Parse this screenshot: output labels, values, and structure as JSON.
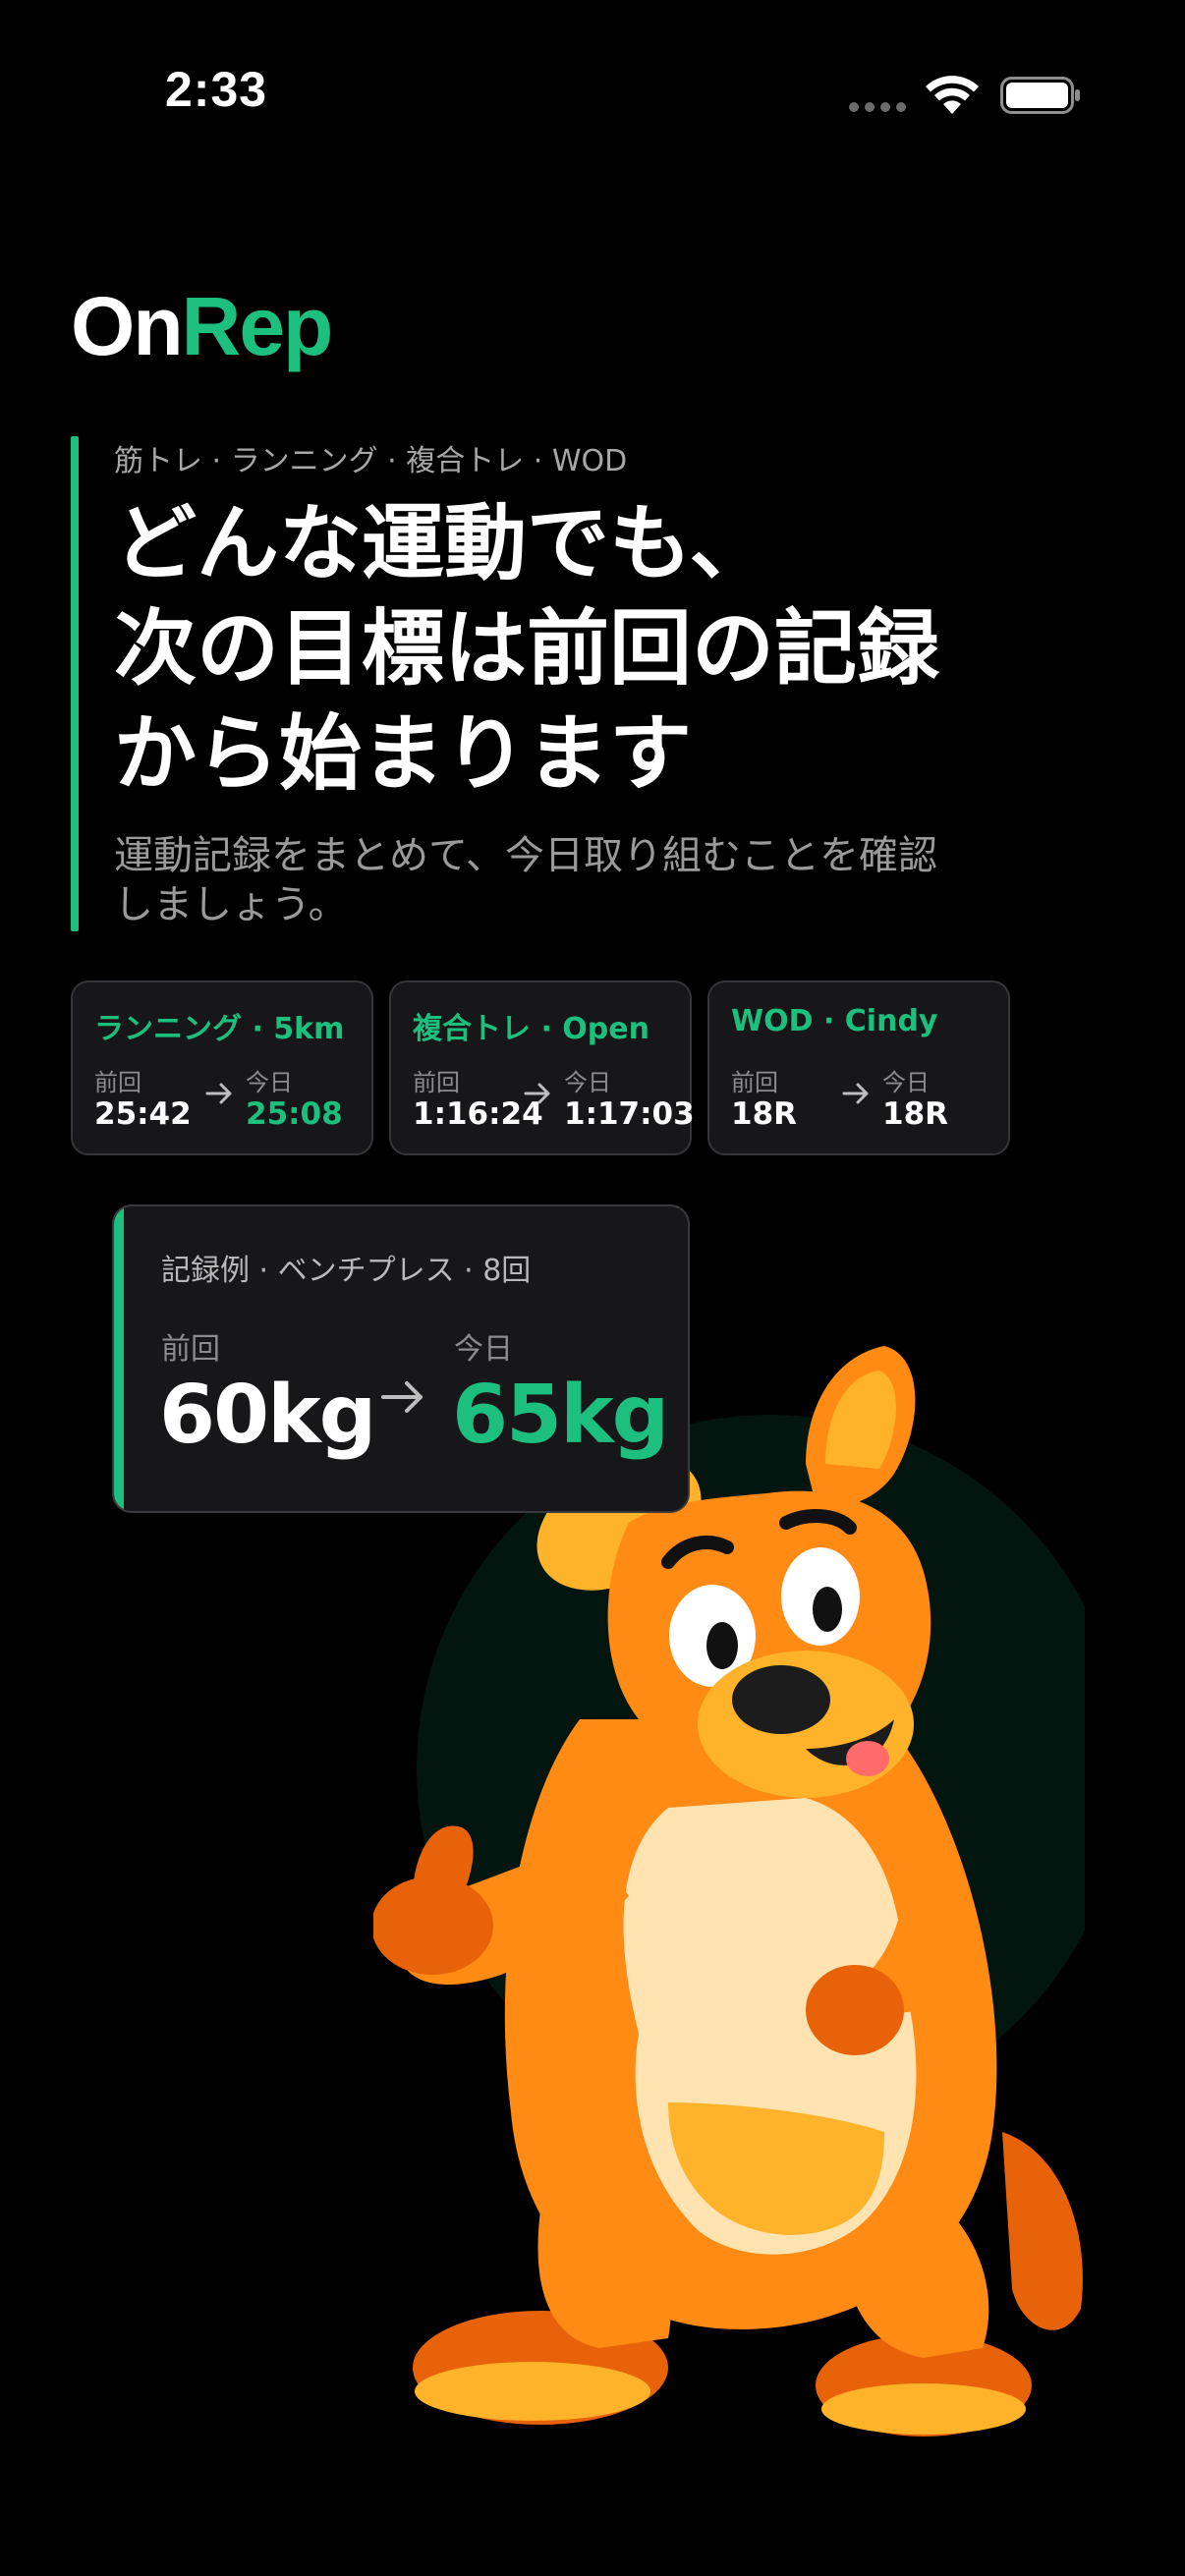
{
  "status_bar": {
    "time": "2:33"
  },
  "brand": {
    "logo_part1": "On",
    "logo_part2": "Rep",
    "accent_color": "#1dbf7f"
  },
  "hero": {
    "tags": "筋トレ · ランニング · 複合トレ · WOD",
    "title_lines": [
      "どんな運動でも、",
      "次の目標は前回の記録",
      "から始まります"
    ],
    "subtitle_lines": [
      "運動記録をまとめて、今日取り組むことを確認",
      "しましょう。"
    ]
  },
  "comparison_cards": [
    {
      "title": "ランニング · 5km",
      "prev_label": "前回",
      "prev_value": "25:42",
      "today_label": "今日",
      "today_value": "25:08",
      "today_color": "#1dbf7f"
    },
    {
      "title": "複合トレ · Open",
      "prev_label": "前回",
      "prev_value": "1:16:24",
      "today_label": "今日",
      "today_value": "1:17:03",
      "today_color": "#ffffff"
    },
    {
      "title": "WOD · Cindy",
      "prev_label": "前回",
      "prev_value": "18R",
      "today_label": "今日",
      "today_value": "18R",
      "today_color": "#ffffff"
    }
  ],
  "record_example": {
    "title": "記録例 · ベンチプレス · 8回",
    "prev_label": "前回",
    "prev_value": "60kg",
    "today_label": "今日",
    "today_value": "65kg"
  },
  "mascot": {
    "icon": "kangaroo-mascot"
  }
}
